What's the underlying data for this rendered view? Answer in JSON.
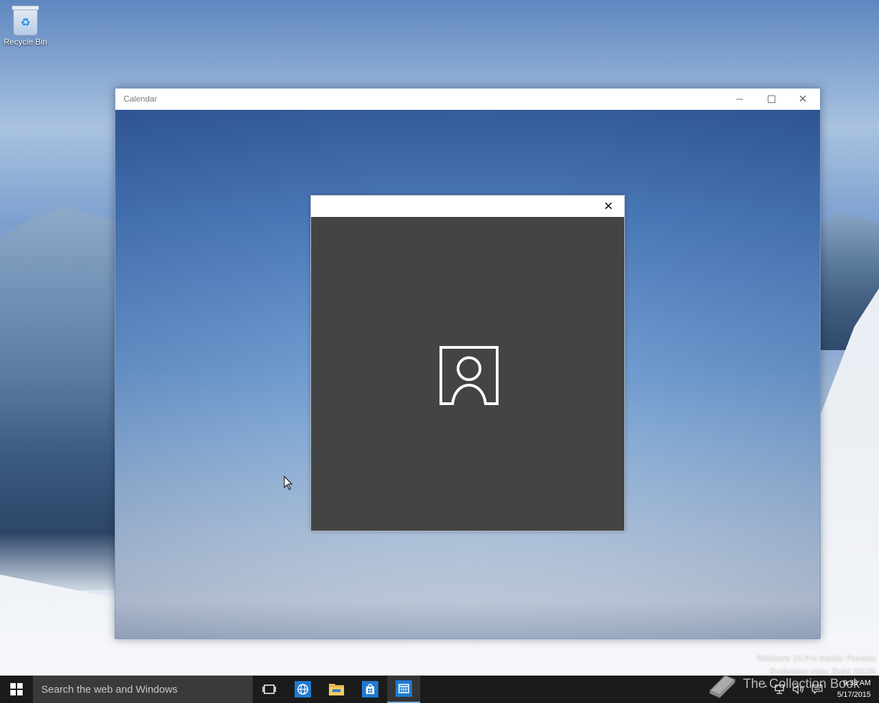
{
  "desktop": {
    "recycle_bin_label": "Recycle Bin"
  },
  "window": {
    "title": "Calendar"
  },
  "dialog": {
    "icon": "account-icon",
    "background_color": "#444444"
  },
  "watermark": {
    "line1": "Windows 10 Pro Insider Preview",
    "line2": "Evaluation copy. Build 10125",
    "overlay_text": "The Collection Book"
  },
  "taskbar": {
    "search_placeholder": "Search the web and Windows",
    "pinned": [
      "task-view-icon",
      "internet-explorer-icon",
      "file-explorer-icon",
      "store-icon",
      "calendar-icon"
    ],
    "active_app": "Calendar",
    "accent_color": "#7da7d9"
  },
  "clock": {
    "time": "9:38 AM",
    "date": "5/17/2015"
  }
}
